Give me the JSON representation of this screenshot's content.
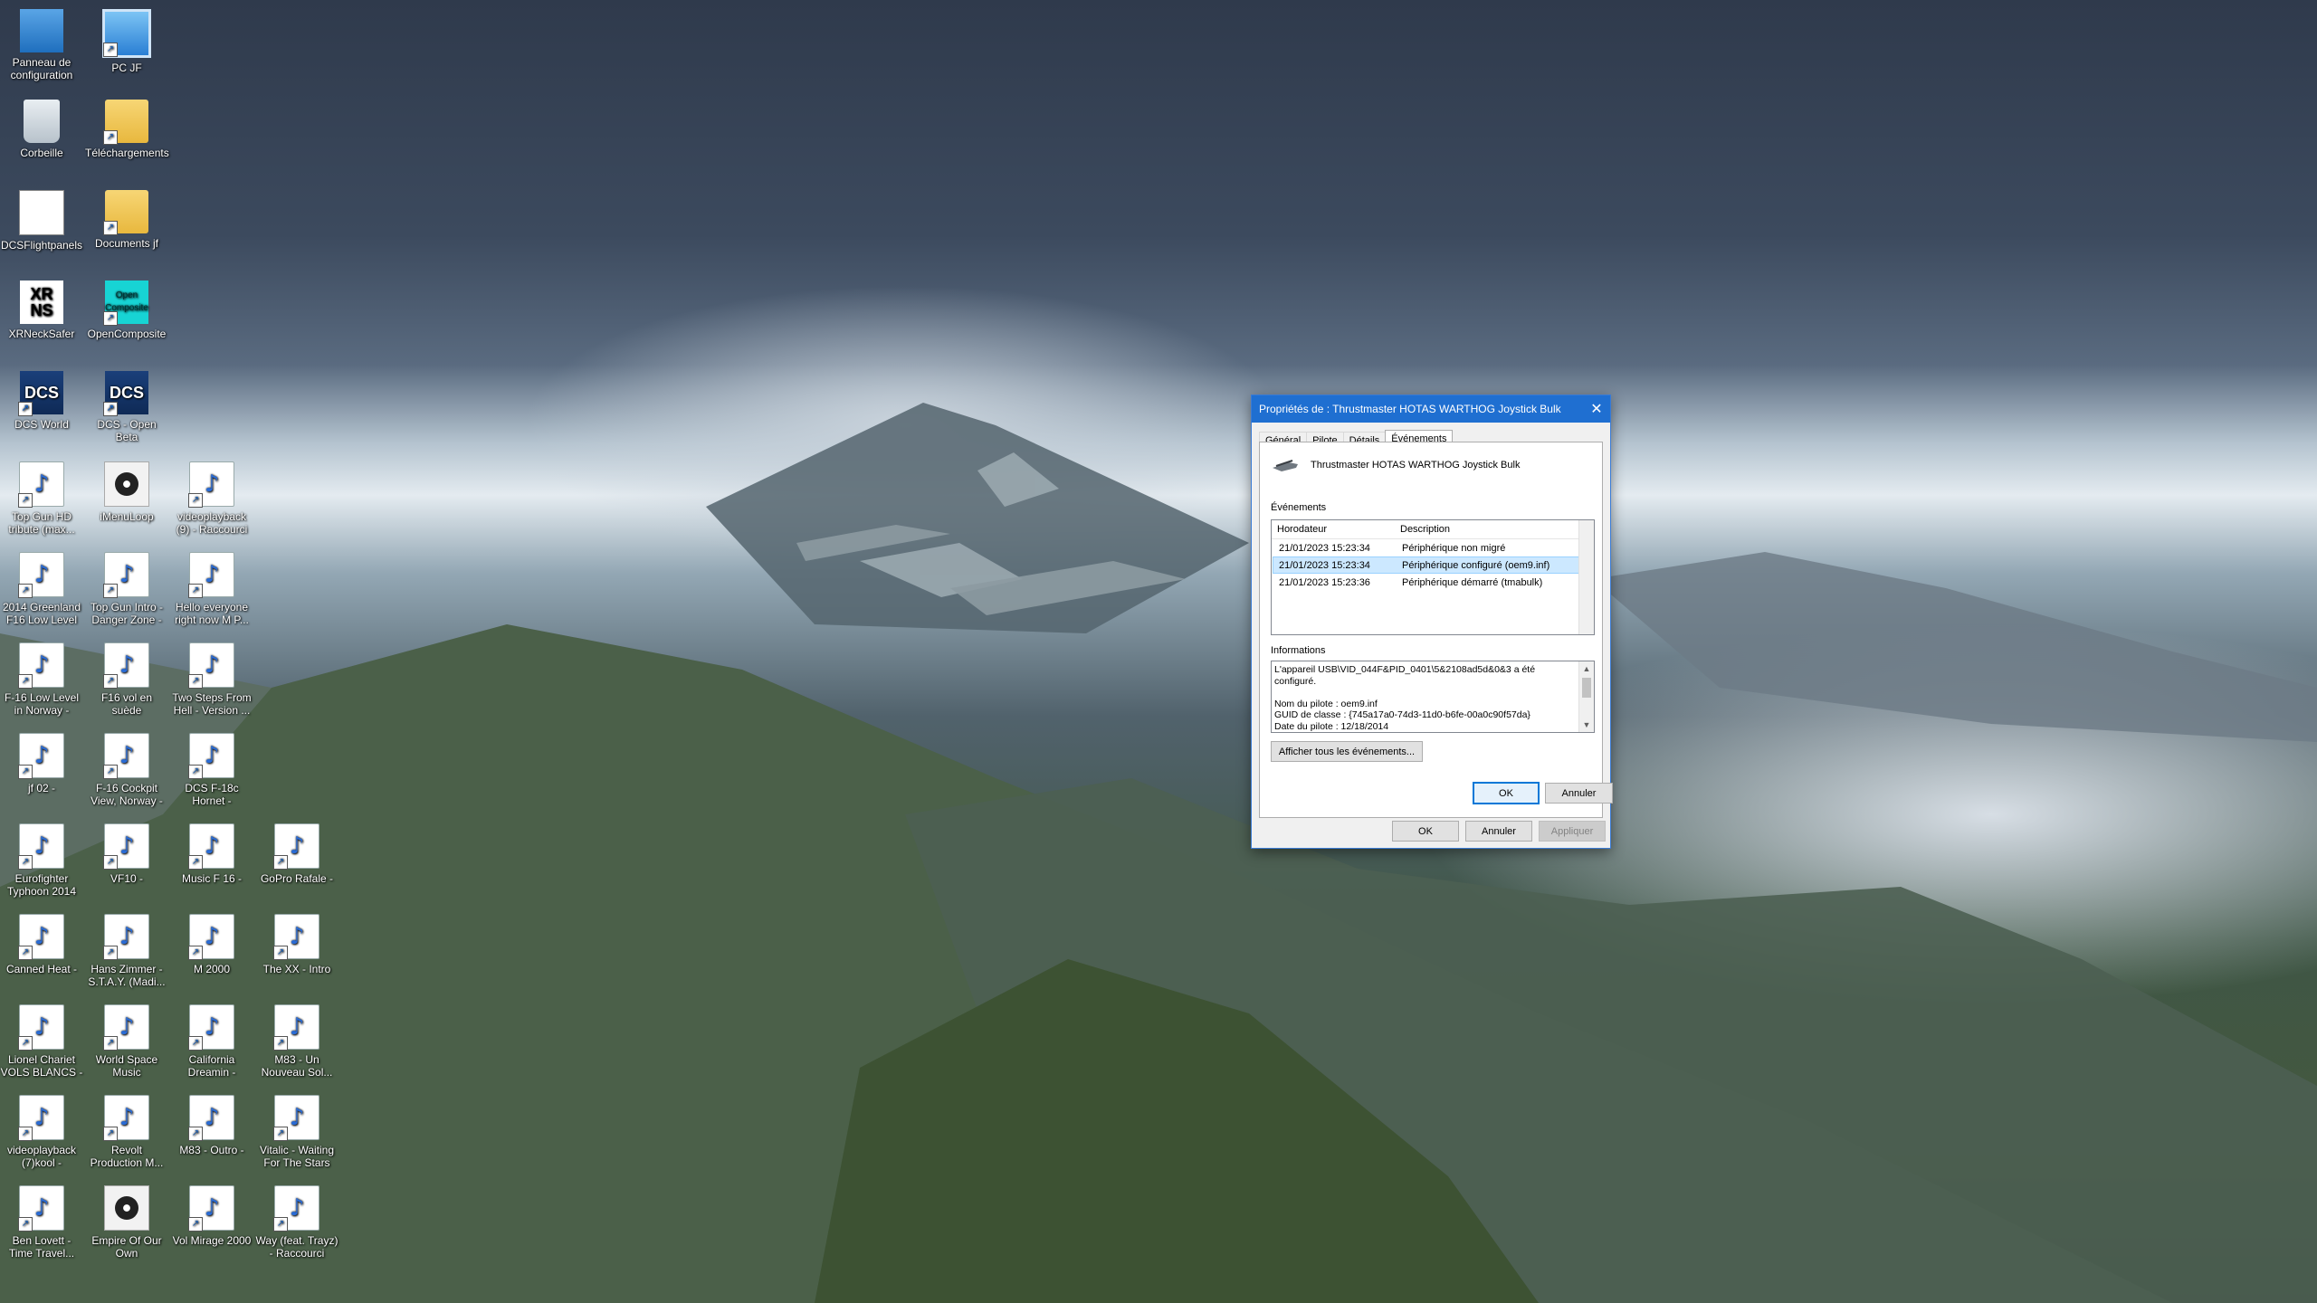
{
  "desktop": {
    "icons": [
      {
        "label": "Panneau de configuration",
        "type": "cp"
      },
      {
        "label": "PC JF",
        "type": "pc"
      },
      {
        "label": "Corbeille",
        "type": "bin"
      },
      {
        "label": "Téléchargements",
        "type": "folder"
      },
      {
        "label": "DCSFlightpanels",
        "type": "panel"
      },
      {
        "label": "Documents jf",
        "type": "folder"
      },
      {
        "label": "XRNeckSafer",
        "type": "xrns",
        "glyph": "XR NS"
      },
      {
        "label": "OpenComposite",
        "type": "oc",
        "glyph": "Open Composite"
      },
      {
        "label": "DCS World",
        "type": "dcs",
        "glyph": "DCS"
      },
      {
        "label": "DCS - Open Beta",
        "type": "dcs",
        "glyph": "DCS"
      },
      {
        "label": "Top Gun HD tribute (max...",
        "type": "file"
      },
      {
        "label": "iMenuLoop",
        "type": "disc"
      },
      {
        "label": "videoplayback (9) - Raccourci",
        "type": "file"
      },
      {
        "label": "2014 Greenland F16 Low Level",
        "type": "file"
      },
      {
        "label": "Top Gun Intro - Danger Zone -",
        "type": "file"
      },
      {
        "label": "Hello everyone right now M P...",
        "type": "file"
      },
      {
        "label": "F-16 Low Level in Norway -",
        "type": "file"
      },
      {
        "label": "F16 vol en suède",
        "type": "file"
      },
      {
        "label": "Two Steps From Hell - Version ...",
        "type": "file"
      },
      {
        "label": "jf 02 -",
        "type": "file"
      },
      {
        "label": "F-16 Cockpit View, Norway -",
        "type": "file"
      },
      {
        "label": "DCS F-18c Hornet -",
        "type": "file"
      },
      {
        "label": "Eurofighter Typhoon 2014",
        "type": "file"
      },
      {
        "label": "VF10 -",
        "type": "file"
      },
      {
        "label": "Music F 16 -",
        "type": "file"
      },
      {
        "label": "GoPro Rafale -",
        "type": "file"
      },
      {
        "label": "Canned Heat -",
        "type": "file"
      },
      {
        "label": "Hans Zimmer - S.T.A.Y. (Madi...",
        "type": "file"
      },
      {
        "label": "M 2000",
        "type": "file"
      },
      {
        "label": "The XX - Intro",
        "type": "file"
      },
      {
        "label": "Lionel Chariet VOLS BLANCS -",
        "type": "file"
      },
      {
        "label": "World Space Music",
        "type": "file"
      },
      {
        "label": "California Dreamin -",
        "type": "file"
      },
      {
        "label": "M83 - Un Nouveau Sol...",
        "type": "file"
      },
      {
        "label": "videoplayback (7)kool -",
        "type": "file"
      },
      {
        "label": "Revolt Production M...",
        "type": "file"
      },
      {
        "label": "M83 - Outro -",
        "type": "file"
      },
      {
        "label": "Vitalic - Waiting For The Stars",
        "type": "file"
      },
      {
        "label": "Ben Lovett - Time Travel...",
        "type": "file"
      },
      {
        "label": "Empire Of Our Own",
        "type": "disc"
      },
      {
        "label": "Vol Mirage 2000",
        "type": "file"
      },
      {
        "label": "Way (feat. Trayz) - Raccourci",
        "type": "file"
      }
    ]
  },
  "dialog": {
    "title": "Propriétés de : Thrustmaster HOTAS WARTHOG Joystick Bulk",
    "close_glyph": "✕",
    "tabs": [
      "Général",
      "Pilote",
      "Détails",
      "Événements"
    ],
    "active_tab": "Événements",
    "device_name": "Thrustmaster HOTAS WARTHOG Joystick Bulk",
    "events_label": "Événements",
    "columns": [
      "Horodateur",
      "Description"
    ],
    "events": [
      {
        "time": "21/01/2023 15:23:34",
        "desc": "Périphérique non migré"
      },
      {
        "time": "21/01/2023 15:23:34",
        "desc": "Périphérique configuré (oem9.inf)"
      },
      {
        "time": "21/01/2023 15:23:36",
        "desc": "Périphérique démarré (tmabulk)"
      }
    ],
    "selected_row": 1,
    "info_label": "Informations",
    "info_text": "L'appareil USB\\VID_044F&PID_0401\\5&2108ad5d&0&3 a été configuré.\n\nNom du pilote : oem9.inf\nGUID de classe : {745a17a0-74d3-11d0-b6fe-00a0c90f57da}\nDate du pilote : 12/18/2014",
    "show_all_button": "Afficher tous les événements...",
    "inner_ok": "OK",
    "inner_cancel": "Annuler",
    "ok": "OK",
    "cancel": "Annuler",
    "apply": "Appliquer"
  }
}
